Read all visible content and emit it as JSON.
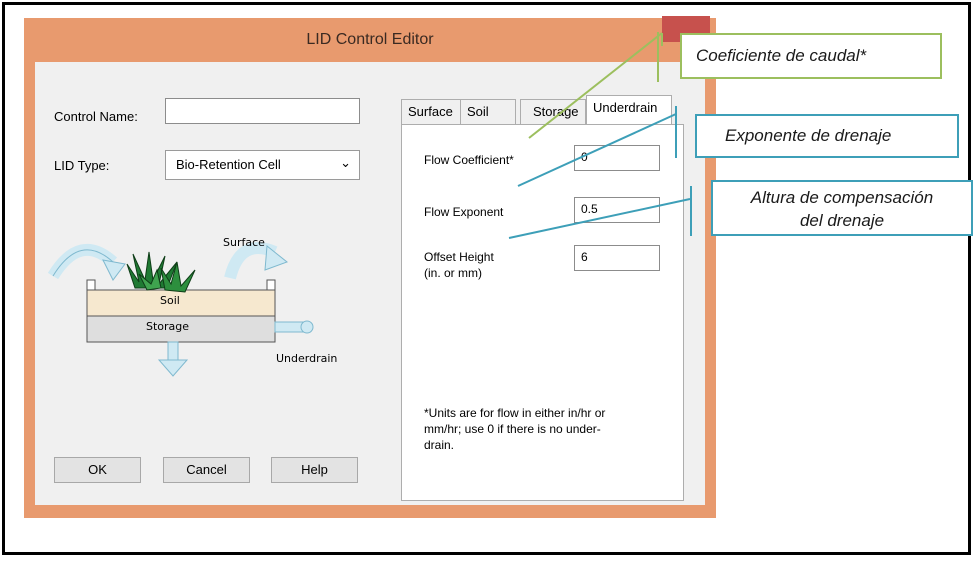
{
  "dialog": {
    "title": "LID Control Editor",
    "control_name_label": "Control Name:",
    "control_name_value": "",
    "lid_type_label": "LID Type:",
    "lid_type_value": "Bio-Retention Cell",
    "diagram": {
      "surface_label": "Surface",
      "soil_label": "Soil",
      "storage_label": "Storage",
      "underdrain_label": "Underdrain"
    },
    "buttons": {
      "ok": "OK",
      "cancel": "Cancel",
      "help": "Help"
    },
    "tabs": [
      {
        "label": "Surface",
        "active": false
      },
      {
        "label": "Soil",
        "active": false
      },
      {
        "label": "Storage",
        "active": false
      },
      {
        "label": "Underdrain",
        "active": true
      }
    ],
    "underdrain": {
      "flow_coefficient_label": "Flow Coefficient*",
      "flow_coefficient_value": "0",
      "flow_exponent_label": "Flow Exponent",
      "flow_exponent_value": "0.5",
      "offset_height_label_1": "Offset Height",
      "offset_height_label_2": "(in. or mm)",
      "offset_height_value": "6",
      "note_1": "*Units are for flow in either in/hr or",
      "note_2": "mm/hr; use 0 if there is no under-",
      "note_3": "drain."
    }
  },
  "callouts": {
    "coeficiente": "Coeficiente de caudal*",
    "exponente": "Exponente de drenaje",
    "altura_1": "Altura de compensación",
    "altura_2": "del drenaje"
  },
  "colors": {
    "window_frame": "#e89a6e",
    "close_button": "#c7514d",
    "callout_green": "#9cbf5e",
    "callout_blue": "#3d9fb8"
  }
}
